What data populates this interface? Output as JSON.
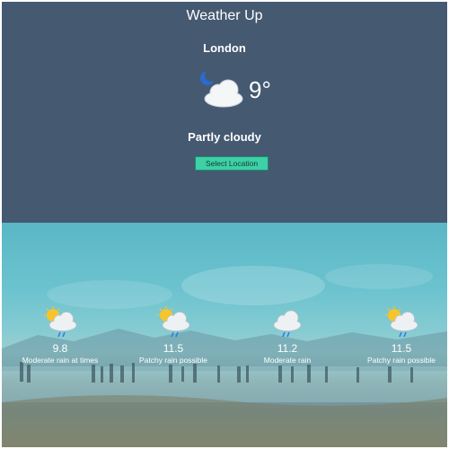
{
  "app": {
    "title": "Weather Up"
  },
  "current": {
    "city": "London",
    "temperature": "9°",
    "condition": "Partly cloudy",
    "icon": "night-partly-cloudy-icon"
  },
  "controls": {
    "select_location_label": "Select Location"
  },
  "forecast": [
    {
      "temp": "9.8",
      "description": "Moderate rain at times",
      "icon": "sun-cloud-rain-icon"
    },
    {
      "temp": "11.5",
      "description": "Patchy rain possible",
      "icon": "sun-cloud-rain-icon"
    },
    {
      "temp": "11.2",
      "description": "Moderate rain",
      "icon": "cloud-rain-icon"
    },
    {
      "temp": "11.5",
      "description": "Patchy rain possible",
      "icon": "sun-cloud-rain-icon"
    }
  ],
  "colors": {
    "header_bg": "#455971",
    "button_bg": "#3ed0a6",
    "text": "#ffffff"
  }
}
